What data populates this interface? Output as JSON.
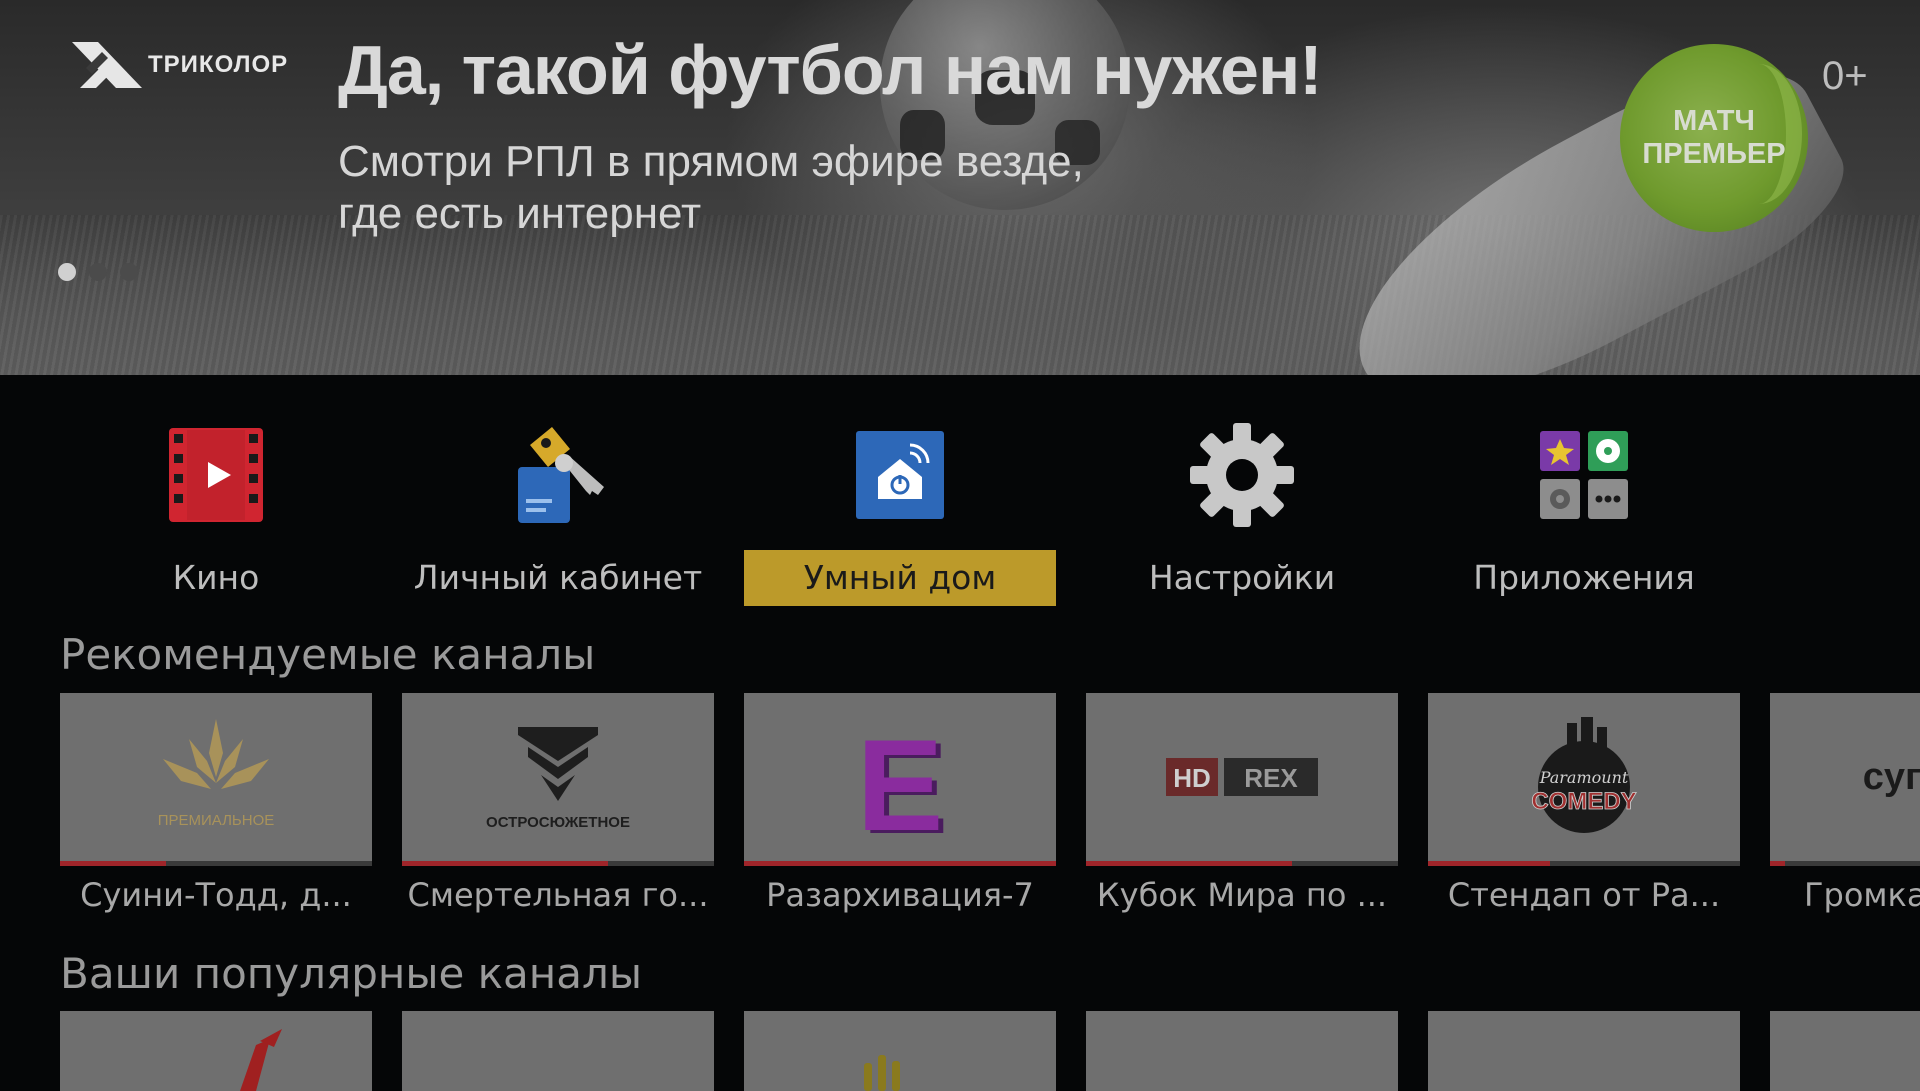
{
  "banner": {
    "brand": "ТРИКОЛОР",
    "headline": "Да, такой футбол нам нужен!",
    "subline_1": "Смотри РПЛ в прямом эфире везде,",
    "subline_2": "где есть интернет",
    "partner_logo_line_1": "МАТЧ",
    "partner_logo_line_2": "ПРЕМЬЕР",
    "age_rating": "0+",
    "slides_total": 3,
    "active_slide": 1
  },
  "menu": {
    "items": [
      {
        "label": "Кино",
        "icon": "film-play-icon"
      },
      {
        "label": "Личный кабинет",
        "icon": "key-tag-icon"
      },
      {
        "label": "Умный дом",
        "icon": "smart-home-icon"
      },
      {
        "label": "Настройки",
        "icon": "gear-icon"
      },
      {
        "label": "Приложения",
        "icon": "apps-grid-icon"
      }
    ],
    "focused_index": 2
  },
  "recommended": {
    "title": "Рекомендуемые каналы",
    "channels": [
      {
        "logo_text": "ПРЕМИАЛЬНОЕ",
        "program": "Суини-Тодд, д...",
        "progress": 0.34
      },
      {
        "logo_text": "ОСТРОСЮЖЕТНОЕ",
        "program": "Смертельная го...",
        "progress": 0.66
      },
      {
        "logo_text": "E",
        "program": "Разархивация-7",
        "progress": 1.0
      },
      {
        "logo_text_1": "HD",
        "logo_text_2": "REX",
        "program": "Кубок Мира по ...",
        "progress": 0.66
      },
      {
        "logo_text_1": "Paramount",
        "logo_text_2": "COMEDY",
        "program": "Стендап от Ра...",
        "progress": 0.39
      },
      {
        "logo_text": "суп",
        "program": "Громка",
        "progress": 0.1
      }
    ]
  },
  "popular": {
    "title": "Ваши популярные каналы"
  },
  "colors": {
    "focus": "#bc9a2a",
    "progress": "#a0252a",
    "card_bg": "#6f6f6f"
  }
}
